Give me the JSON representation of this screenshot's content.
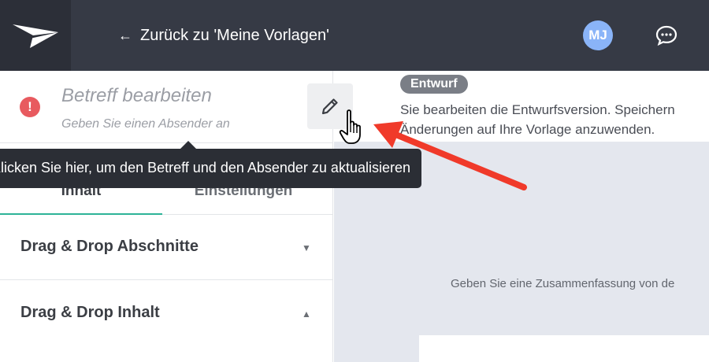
{
  "topbar": {
    "back_label": "Zurück zu 'Meine Vorlagen'",
    "avatar_initials": "MJ",
    "logo_icon": "paper-plane-logo",
    "chat_icon": "chat-bubble-icon"
  },
  "subject": {
    "title": "Betreff bearbeiten",
    "sender": "Geben Sie einen Absender an",
    "status_icon": "error-icon",
    "edit_icon": "pencil-icon"
  },
  "tooltip": {
    "text": "Klicken Sie hier, um den Betreff und den Absender zu aktualisieren"
  },
  "tabs": [
    {
      "label": "Inhalt",
      "active": true
    },
    {
      "label": "Einstellungen",
      "active": false
    }
  ],
  "sections": [
    {
      "label": "Drag & Drop Abschnitte",
      "state": "collapsed"
    },
    {
      "label": "Drag & Drop Inhalt",
      "state": "expanded"
    }
  ],
  "draft": {
    "badge": "Entwurf",
    "text_line1": "Sie bearbeiten die Entwurfsversion. Speichern",
    "text_line2": "Änderungen auf Ihre Vorlage anzuwenden."
  },
  "preview": {
    "summary": "Geben Sie eine Zusammenfassung von de"
  },
  "colors": {
    "topbar": "#363a45",
    "accent": "#2db397",
    "error": "#e85a5f",
    "annotation_arrow": "#f03a2a"
  }
}
